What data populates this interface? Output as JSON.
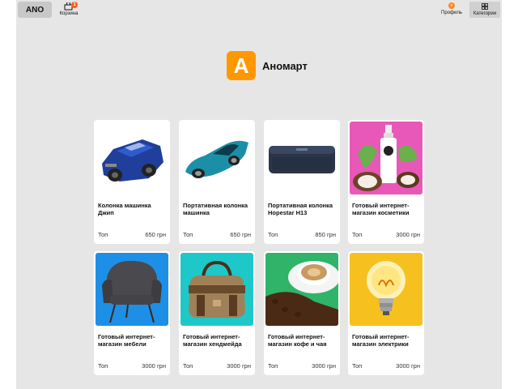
{
  "header": {
    "logo": "ANO",
    "cart_label": "Корзина",
    "cart_count": "1",
    "profile_label": "Профиль",
    "profile_initial": "n",
    "categories_label": "Категории"
  },
  "brand": {
    "letter": "A",
    "name": "Аномарт"
  },
  "products": [
    {
      "title": "Колонка машинка Джип",
      "tag": "Топ",
      "price": "650 грн",
      "icon": "blue-jeep-image"
    },
    {
      "title": "Портативная колонка машинка",
      "tag": "Топ",
      "price": "650 грн",
      "icon": "sports-car-image"
    },
    {
      "title": "Портативная колонка Hopestar H13",
      "tag": "Топ",
      "price": "850 грн",
      "icon": "speaker-image"
    },
    {
      "title": "Готовый интернет-магазин косметики",
      "tag": "Топ",
      "price": "3000 грн",
      "icon": "cosmetics-image"
    },
    {
      "title": "Готовый интернет-магазин мебели",
      "tag": "Топ",
      "price": "3000 грн",
      "icon": "armchair-image"
    },
    {
      "title": "Готовый интернет-магазин хендмейда",
      "tag": "Топ",
      "price": "3000 грн",
      "icon": "bag-image"
    },
    {
      "title": "Готовый интернет-магазин кофе и чая",
      "tag": "Топ",
      "price": "3000 грн",
      "icon": "coffee-image"
    },
    {
      "title": "Готовый интернет-магазин электрики",
      "tag": "Топ",
      "price": "3000 грн",
      "icon": "lightbulb-image"
    }
  ],
  "colors": {
    "accent": "#ff9800",
    "badge": "#ff5a1f",
    "background": "#e6e6e6"
  }
}
